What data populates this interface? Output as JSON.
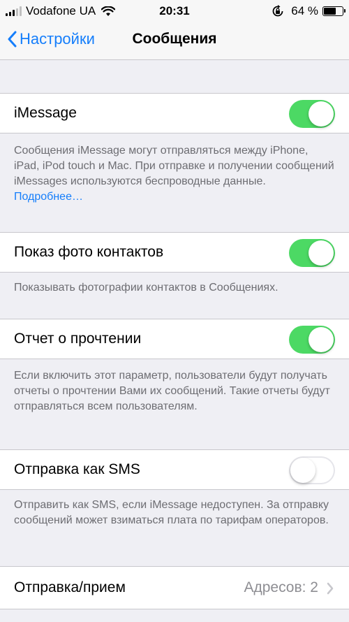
{
  "status_bar": {
    "carrier": "Vodafone UA",
    "time": "20:31",
    "battery_percent": "64 %",
    "battery_level": 0.64
  },
  "nav": {
    "back_label": "Настройки",
    "title": "Сообщения"
  },
  "settings": {
    "imessage": {
      "label": "iMessage",
      "enabled": true,
      "description": "Сообщения iMessage могут отправляться между iPhone, iPad, iPod touch и Mac. При отправке и получении сообщений iMessages используются беспроводные данные. ",
      "link": "Подробнее…"
    },
    "contact_photos": {
      "label": "Показ фото контактов",
      "enabled": true,
      "description": "Показывать фотографии контактов в Сообщениях."
    },
    "read_receipts": {
      "label": "Отчет о прочтении",
      "enabled": true,
      "description": "Если включить этот параметр, пользователи будут получать отчеты о прочтении Вами их сообщений. Такие отчеты будут отправляться всем пользователям."
    },
    "send_as_sms": {
      "label": "Отправка как SMS",
      "enabled": false,
      "description": "Отправить как SMS, если iMessage недоступен. За отправку сообщений может взиматься плата по тарифам операторов."
    },
    "send_receive": {
      "label": "Отправка/прием",
      "value": "Адресов: 2"
    }
  },
  "colors": {
    "accent": "#157efb",
    "toggle_on": "#4cd964",
    "background": "#efeff4"
  }
}
